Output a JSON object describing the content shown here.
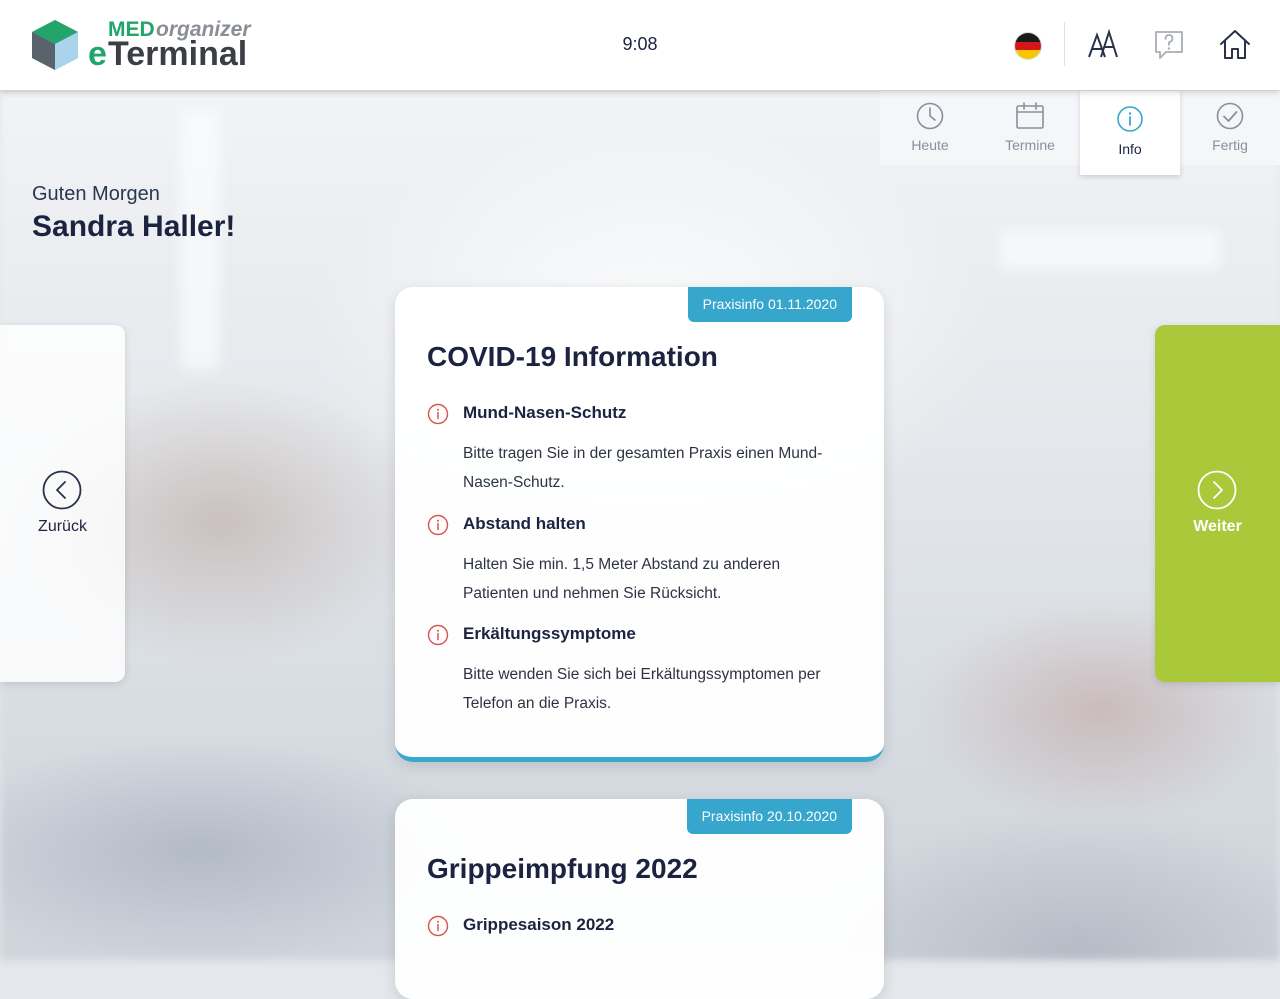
{
  "header": {
    "logo_med": "MED",
    "logo_organizer": "organizer",
    "logo_e": "e",
    "logo_terminal": "Terminal",
    "time": "9:08",
    "language": "de-flag-icon",
    "icons": [
      "font-size-icon",
      "help-icon",
      "home-icon"
    ]
  },
  "tabs": [
    {
      "label": "Heute",
      "icon": "clock-icon"
    },
    {
      "label": "Termine",
      "icon": "calendar-icon"
    },
    {
      "label": "Info",
      "icon": "info-icon",
      "active": true
    },
    {
      "label": "Fertig",
      "icon": "check-circle-icon"
    }
  ],
  "greeting": {
    "line1": "Guten Morgen",
    "name": "Sandra Haller!"
  },
  "nav": {
    "back_label": "Zurück",
    "next_label": "Weiter"
  },
  "cards": [
    {
      "badge": "Praxisinfo 01.11.2020",
      "title": "COVID-19 Information",
      "items": [
        {
          "heading": "Mund-Nasen-Schutz",
          "text": "Bitte tragen Sie in der gesamten Praxis einen Mund-Nasen-Schutz."
        },
        {
          "heading": "Abstand halten",
          "text": "Halten Sie min. 1,5 Meter Abstand zu anderen Patienten und nehmen Sie Rücksicht."
        },
        {
          "heading": "Erkältungssymptome",
          "text": "Bitte wenden Sie sich bei Erkältungssymptomen per Telefon an die Praxis."
        }
      ]
    },
    {
      "badge": "Praxisinfo 20.10.2020",
      "title": "Grippeimpfung 2022",
      "items": [
        {
          "heading": "Grippesaison 2022",
          "text": ""
        }
      ]
    }
  ],
  "colors": {
    "accent_blue": "#36a6cc",
    "next_green": "#a9c93b",
    "info_red": "#d9534f",
    "logo_green": "#23a46b",
    "text_dark": "#1c2340"
  }
}
